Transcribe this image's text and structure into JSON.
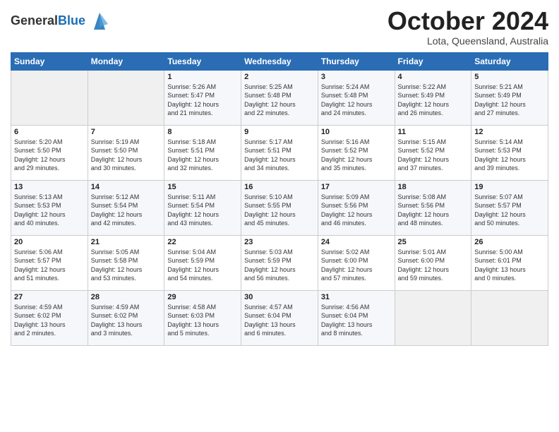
{
  "header": {
    "logo": {
      "line1": "General",
      "line2": "Blue"
    },
    "title": "October 2024",
    "location": "Lota, Queensland, Australia"
  },
  "weekdays": [
    "Sunday",
    "Monday",
    "Tuesday",
    "Wednesday",
    "Thursday",
    "Friday",
    "Saturday"
  ],
  "weeks": [
    [
      {
        "day": "",
        "content": ""
      },
      {
        "day": "",
        "content": ""
      },
      {
        "day": "1",
        "content": "Sunrise: 5:26 AM\nSunset: 5:47 PM\nDaylight: 12 hours\nand 21 minutes."
      },
      {
        "day": "2",
        "content": "Sunrise: 5:25 AM\nSunset: 5:48 PM\nDaylight: 12 hours\nand 22 minutes."
      },
      {
        "day": "3",
        "content": "Sunrise: 5:24 AM\nSunset: 5:48 PM\nDaylight: 12 hours\nand 24 minutes."
      },
      {
        "day": "4",
        "content": "Sunrise: 5:22 AM\nSunset: 5:49 PM\nDaylight: 12 hours\nand 26 minutes."
      },
      {
        "day": "5",
        "content": "Sunrise: 5:21 AM\nSunset: 5:49 PM\nDaylight: 12 hours\nand 27 minutes."
      }
    ],
    [
      {
        "day": "6",
        "content": "Sunrise: 5:20 AM\nSunset: 5:50 PM\nDaylight: 12 hours\nand 29 minutes."
      },
      {
        "day": "7",
        "content": "Sunrise: 5:19 AM\nSunset: 5:50 PM\nDaylight: 12 hours\nand 30 minutes."
      },
      {
        "day": "8",
        "content": "Sunrise: 5:18 AM\nSunset: 5:51 PM\nDaylight: 12 hours\nand 32 minutes."
      },
      {
        "day": "9",
        "content": "Sunrise: 5:17 AM\nSunset: 5:51 PM\nDaylight: 12 hours\nand 34 minutes."
      },
      {
        "day": "10",
        "content": "Sunrise: 5:16 AM\nSunset: 5:52 PM\nDaylight: 12 hours\nand 35 minutes."
      },
      {
        "day": "11",
        "content": "Sunrise: 5:15 AM\nSunset: 5:52 PM\nDaylight: 12 hours\nand 37 minutes."
      },
      {
        "day": "12",
        "content": "Sunrise: 5:14 AM\nSunset: 5:53 PM\nDaylight: 12 hours\nand 39 minutes."
      }
    ],
    [
      {
        "day": "13",
        "content": "Sunrise: 5:13 AM\nSunset: 5:53 PM\nDaylight: 12 hours\nand 40 minutes."
      },
      {
        "day": "14",
        "content": "Sunrise: 5:12 AM\nSunset: 5:54 PM\nDaylight: 12 hours\nand 42 minutes."
      },
      {
        "day": "15",
        "content": "Sunrise: 5:11 AM\nSunset: 5:54 PM\nDaylight: 12 hours\nand 43 minutes."
      },
      {
        "day": "16",
        "content": "Sunrise: 5:10 AM\nSunset: 5:55 PM\nDaylight: 12 hours\nand 45 minutes."
      },
      {
        "day": "17",
        "content": "Sunrise: 5:09 AM\nSunset: 5:56 PM\nDaylight: 12 hours\nand 46 minutes."
      },
      {
        "day": "18",
        "content": "Sunrise: 5:08 AM\nSunset: 5:56 PM\nDaylight: 12 hours\nand 48 minutes."
      },
      {
        "day": "19",
        "content": "Sunrise: 5:07 AM\nSunset: 5:57 PM\nDaylight: 12 hours\nand 50 minutes."
      }
    ],
    [
      {
        "day": "20",
        "content": "Sunrise: 5:06 AM\nSunset: 5:57 PM\nDaylight: 12 hours\nand 51 minutes."
      },
      {
        "day": "21",
        "content": "Sunrise: 5:05 AM\nSunset: 5:58 PM\nDaylight: 12 hours\nand 53 minutes."
      },
      {
        "day": "22",
        "content": "Sunrise: 5:04 AM\nSunset: 5:59 PM\nDaylight: 12 hours\nand 54 minutes."
      },
      {
        "day": "23",
        "content": "Sunrise: 5:03 AM\nSunset: 5:59 PM\nDaylight: 12 hours\nand 56 minutes."
      },
      {
        "day": "24",
        "content": "Sunrise: 5:02 AM\nSunset: 6:00 PM\nDaylight: 12 hours\nand 57 minutes."
      },
      {
        "day": "25",
        "content": "Sunrise: 5:01 AM\nSunset: 6:00 PM\nDaylight: 12 hours\nand 59 minutes."
      },
      {
        "day": "26",
        "content": "Sunrise: 5:00 AM\nSunset: 6:01 PM\nDaylight: 13 hours\nand 0 minutes."
      }
    ],
    [
      {
        "day": "27",
        "content": "Sunrise: 4:59 AM\nSunset: 6:02 PM\nDaylight: 13 hours\nand 2 minutes."
      },
      {
        "day": "28",
        "content": "Sunrise: 4:59 AM\nSunset: 6:02 PM\nDaylight: 13 hours\nand 3 minutes."
      },
      {
        "day": "29",
        "content": "Sunrise: 4:58 AM\nSunset: 6:03 PM\nDaylight: 13 hours\nand 5 minutes."
      },
      {
        "day": "30",
        "content": "Sunrise: 4:57 AM\nSunset: 6:04 PM\nDaylight: 13 hours\nand 6 minutes."
      },
      {
        "day": "31",
        "content": "Sunrise: 4:56 AM\nSunset: 6:04 PM\nDaylight: 13 hours\nand 8 minutes."
      },
      {
        "day": "",
        "content": ""
      },
      {
        "day": "",
        "content": ""
      }
    ]
  ]
}
